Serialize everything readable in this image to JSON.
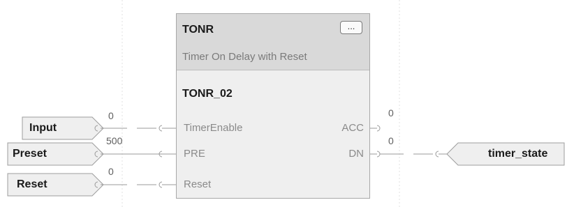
{
  "block": {
    "type": "TONR",
    "description": "Timer On Delay with Reset",
    "instance": "TONR_02",
    "dots_label": "...",
    "inputs": [
      "TimerEnable",
      "PRE",
      "Reset"
    ],
    "outputs": [
      "ACC",
      "DN"
    ]
  },
  "input_tags": [
    {
      "name": "Input",
      "value": "0"
    },
    {
      "name": "Preset",
      "value": "500"
    },
    {
      "name": "Reset",
      "value": "0"
    }
  ],
  "output_values": {
    "acc": "0",
    "dn": "0"
  },
  "output_tag": {
    "name": "timer_state"
  },
  "colors": {
    "header": "#d9d9d9",
    "body": "#efefef",
    "tag_fill": "#efefef",
    "wire": "#9a9a9a",
    "pin_text": "#8a8a8a"
  }
}
